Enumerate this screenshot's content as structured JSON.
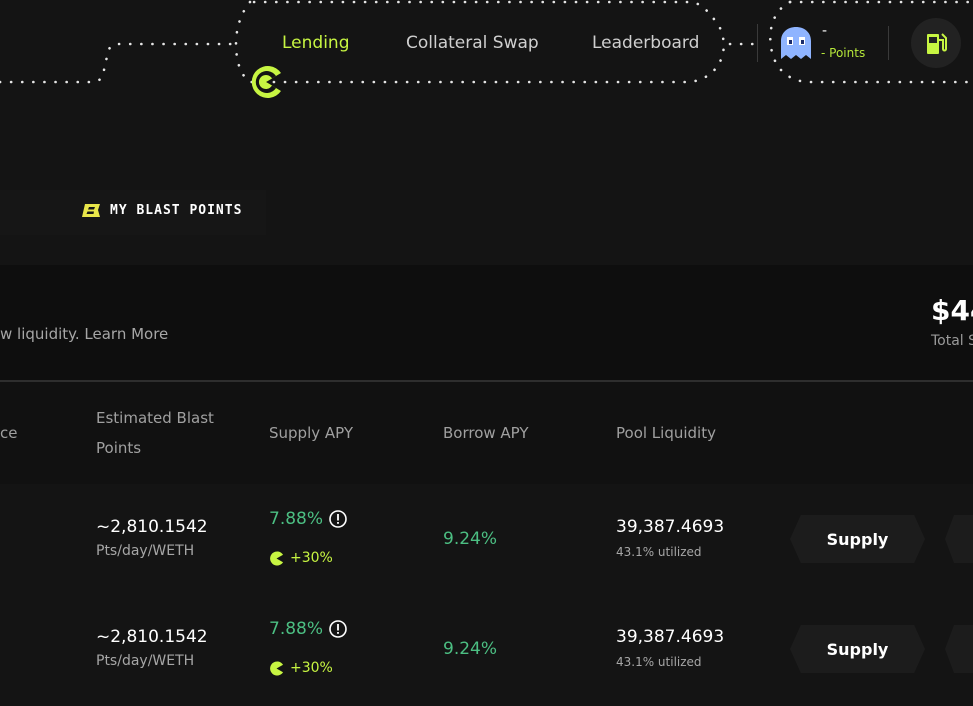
{
  "colors": {
    "accent": "#c7f542",
    "positive": "#4cbf83",
    "background": "#141414"
  },
  "nav": {
    "links": [
      {
        "label": "Lending",
        "active": true
      },
      {
        "label": "Collateral Swap",
        "active": false
      },
      {
        "label": "Leaderboard",
        "active": false
      }
    ],
    "points": {
      "value": "-",
      "label": "- Points"
    },
    "gas_icon": "gas-pump-icon",
    "logo_icon": "pacman-logo-icon",
    "avatar_icon": "ghost-icon"
  },
  "blast": {
    "tab_label": "MY BLAST POINTS",
    "icon": "blast-logo-icon"
  },
  "info": {
    "text": "w liquidity. Learn More",
    "total_value": "$44",
    "total_label": "Total S"
  },
  "table": {
    "headers": {
      "balance": "ce",
      "est_points": "Estimated Blast Points",
      "supply_apy": "Supply APY",
      "borrow_apy": "Borrow APY",
      "pool_liquidity": "Pool Liquidity"
    },
    "rows": [
      {
        "points": "~2,810.1542",
        "points_unit": "Pts/day/WETH",
        "supply_apy": "7.88%",
        "boost": "+30%",
        "borrow_apy": "9.24%",
        "liquidity": "39,387.4693",
        "utilized": "43.1% utilized",
        "action": "Supply"
      },
      {
        "points": "~2,810.1542",
        "points_unit": "Pts/day/WETH",
        "supply_apy": "7.88%",
        "boost": "+30%",
        "borrow_apy": "9.24%",
        "liquidity": "39,387.4693",
        "utilized": "43.1% utilized",
        "action": "Supply"
      }
    ]
  }
}
